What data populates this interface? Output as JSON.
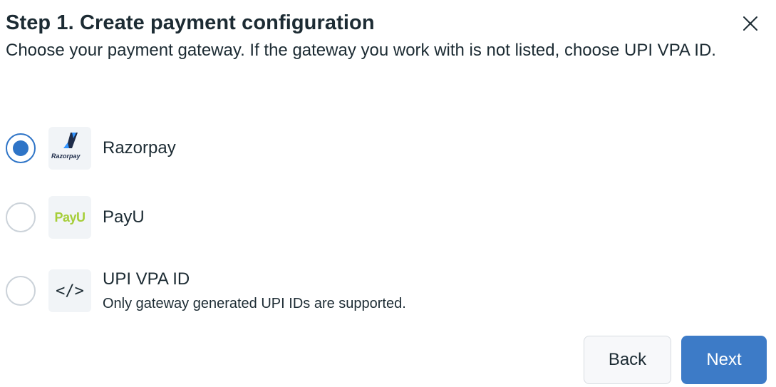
{
  "dialog": {
    "title": "Step 1. Create payment configuration",
    "subtitle": "Choose your payment gateway. If the gateway you work with is not listed, choose UPI VPA ID.",
    "close_icon": "close-icon"
  },
  "options": [
    {
      "label": "Razorpay",
      "logo_text": "Razorpay",
      "icon": "razorpay-logo",
      "selected": true
    },
    {
      "label": "PayU",
      "logo_text": "PayU",
      "icon": "payu-logo",
      "selected": false
    },
    {
      "label": "UPI VPA ID",
      "description": "Only gateway generated UPI IDs are supported.",
      "logo_text": "</>",
      "icon": "code-icon",
      "selected": false
    }
  ],
  "buttons": {
    "back_label": "Back",
    "next_label": "Next"
  },
  "colors": {
    "accent": "#2e74c7",
    "next_button": "#3d7bc7",
    "payu_green": "#a6ce39",
    "razorpay_blue": "#3395ff"
  }
}
